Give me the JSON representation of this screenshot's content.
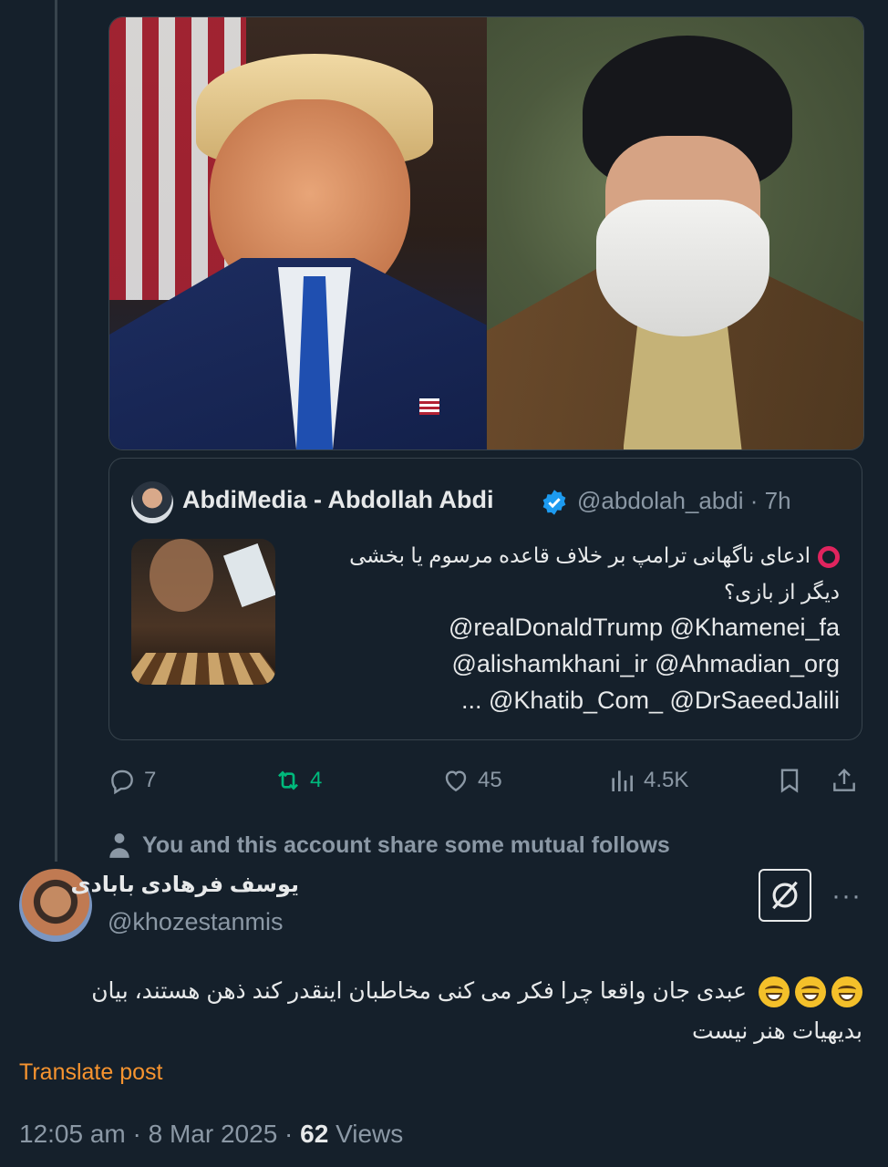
{
  "quoted_images": [
    {
      "name": "trump-portrait"
    },
    {
      "name": "khamenei-portrait"
    }
  ],
  "quoted_tweet": {
    "display_name": "AbdiMedia - Abdollah Abdi",
    "handle": "@abdolah_abdi",
    "time": "· 7h",
    "text_line1": "ادعای ناگهانی ترامپ بر خلاف قاعده مرسوم یا بخشی",
    "text_line2": "دیگر از بازی؟",
    "mentions": [
      "@realDonaldTrump @Khamenei_fa",
      "@alishamkhani_ir @Ahmadian_org",
      "... @Khatib_Com_ @DrSaeedJalili"
    ]
  },
  "actions": {
    "replies": "7",
    "reposts": "4",
    "likes": "45",
    "views": "4.5K"
  },
  "mutual_follows": "You and this account share some mutual follows",
  "reply": {
    "display_name": "یوسف فرهادی بابادی",
    "handle": "@khozestanmis",
    "text_line1": "عبدی جان واقعا چرا فکر می کنی مخاطبان اینقدر کند ذهن هستند، بیان",
    "text_line2": "بدیهیات هنر نیست",
    "translate_label": "Translate post",
    "time": "12:05 am · 8 Mar 2025 · ",
    "views_count": "62",
    "views_label": " Views"
  },
  "colors": {
    "background": "#15202b",
    "text": "#e7e9ea",
    "muted": "#8b98a5",
    "repost_active": "#00ba7c",
    "verified": "#1d9bf0",
    "translate": "#f7942f"
  }
}
